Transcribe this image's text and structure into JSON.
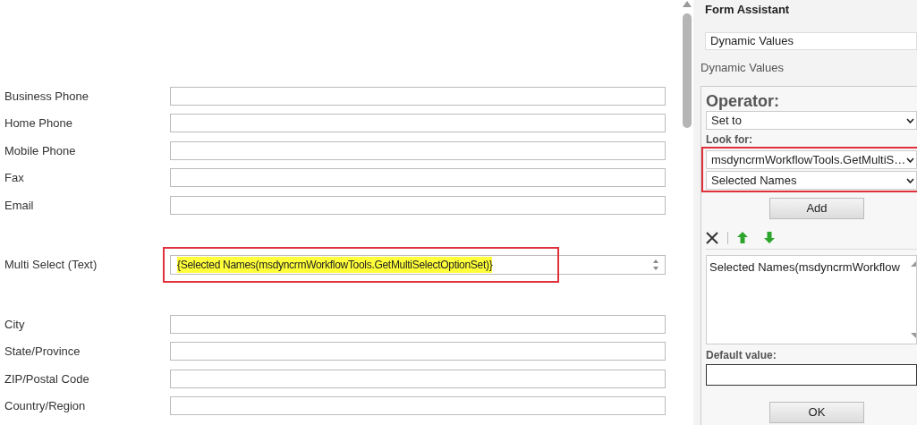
{
  "form": {
    "fields": [
      {
        "label": "Business Phone",
        "highlighted": false,
        "gap_after": false
      },
      {
        "label": "Home Phone",
        "highlighted": false,
        "gap_after": false
      },
      {
        "label": "Mobile Phone",
        "highlighted": false,
        "gap_after": false
      },
      {
        "label": "Fax",
        "highlighted": false,
        "gap_after": false
      },
      {
        "label": "Email",
        "highlighted": false,
        "gap_after": true
      },
      {
        "label": "Multi Select (Text)",
        "value": "{Selected Names(msdyncrmWorkflowTools.GetMultiSelectOptionSet)}",
        "highlighted": true,
        "gap_after": true
      },
      {
        "label": "City",
        "highlighted": false,
        "gap_after": false
      },
      {
        "label": "State/Province",
        "highlighted": false,
        "gap_after": false
      },
      {
        "label": "ZIP/Postal Code",
        "highlighted": false,
        "gap_after": false
      },
      {
        "label": "Country/Region",
        "highlighted": false,
        "gap_after": false
      }
    ]
  },
  "form_assistant": {
    "title": "Form Assistant",
    "mode_select": "Dynamic Values",
    "section_label": "Dynamic Values",
    "operator_label": "Operator:",
    "operator_value": "Set to",
    "look_for_label": "Look for:",
    "look_for_entity": "msdyncrmWorkflowTools.GetMultiS…",
    "look_for_attribute": "Selected Names",
    "add_button": "Add",
    "list_items": [
      "Selected Names(msdyncrmWorkflow"
    ],
    "default_value_label": "Default value:",
    "ok_button": "OK"
  }
}
